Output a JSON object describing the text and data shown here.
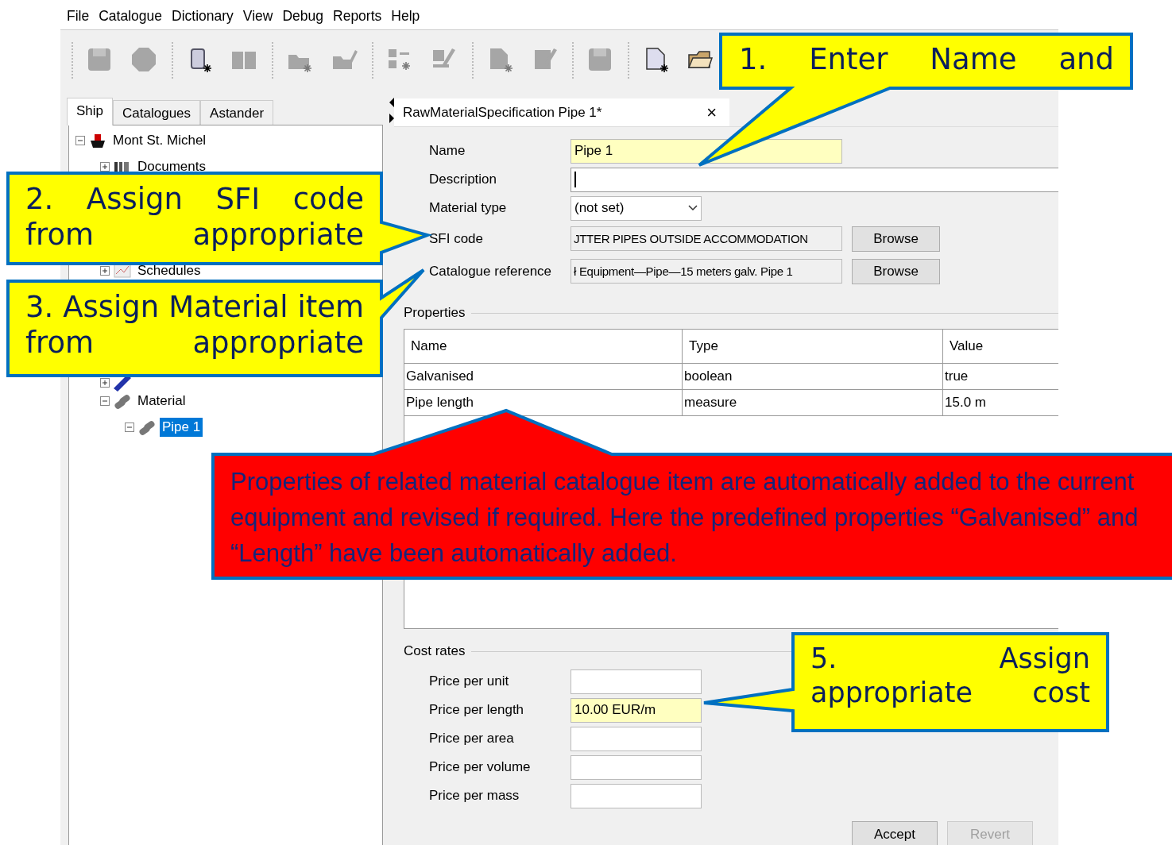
{
  "menu": [
    "File",
    "Catalogue",
    "Dictionary",
    "View",
    "Debug",
    "Reports",
    "Help"
  ],
  "toolbar": [
    {
      "buttons": [
        {
          "disabled": true
        },
        {
          "disabled": true
        }
      ]
    },
    {
      "buttons": [
        {
          "disabled": false
        },
        {
          "disabled": true
        }
      ]
    },
    {
      "buttons": [
        {
          "disabled": true
        },
        {
          "disabled": true
        }
      ]
    },
    {
      "buttons": [
        {
          "disabled": true
        },
        {
          "disabled": true
        }
      ]
    },
    {
      "buttons": [
        {
          "disabled": true
        },
        {
          "disabled": true
        }
      ]
    },
    {
      "buttons": [
        {
          "disabled": true
        }
      ]
    },
    {
      "buttons": [
        {
          "disabled": false
        },
        {
          "disabled": false
        }
      ]
    }
  ],
  "side_tabs": [
    {
      "label": "Ship",
      "selected": true
    },
    {
      "label": "Catalogues",
      "selected": false
    },
    {
      "label": "Astander",
      "selected": false
    }
  ],
  "tree": [
    {
      "label": "Mont St. Michel",
      "expanded": true,
      "selected": false,
      "children": [
        {
          "label": "Documents",
          "expanded": false,
          "selected": false
        },
        {
          "label": "Schedules",
          "expanded": false,
          "selected": false
        },
        {
          "expanded": false
        },
        {
          "label": "Material",
          "expanded": true,
          "selected": false,
          "children": [
            {
              "label": "Pipe 1",
              "expanded": true,
              "selected": true
            }
          ]
        }
      ]
    }
  ],
  "editor": {
    "tab": {
      "title": "RawMaterialSpecification Pipe 1*",
      "close": "×"
    },
    "fields": [
      {
        "kind": "text",
        "label": "Name",
        "value": "Pipe 1",
        "highlighted": true,
        "focused": false
      },
      {
        "kind": "text",
        "label": "Description",
        "highlighted": false,
        "focused": true
      },
      {
        "kind": "select",
        "label": "Material type",
        "value": "(not set)"
      },
      {
        "kind": "browse",
        "label": "SFI code",
        "value": "JTTER PIPES OUTSIDE ACCOMMODATION",
        "button": "Browse"
      },
      {
        "kind": "browse",
        "label": "Catalogue reference",
        "value": "ł Equipment—Pipe—15 meters galv. Pipe 1",
        "button": "Browse"
      }
    ],
    "properties": {
      "title": "Properties",
      "columns": [
        "Name",
        "Type",
        "Value"
      ],
      "rows": [
        [
          "Galvanised",
          "boolean",
          "true"
        ],
        [
          "Pipe length",
          "measure",
          "15.0 m"
        ]
      ]
    },
    "cost_rates": {
      "title": "Cost rates",
      "fields": [
        {
          "label": "Price per unit",
          "highlighted": false
        },
        {
          "label": "Price per length",
          "value": "10.00 EUR/m",
          "highlighted": true
        },
        {
          "label": "Price per area",
          "highlighted": false
        },
        {
          "label": "Price per volume",
          "highlighted": false
        },
        {
          "label": "Price per mass",
          "highlighted": false
        }
      ]
    },
    "buttons": [
      {
        "label": "Accept",
        "disabled": false
      },
      {
        "label": "Revert",
        "disabled": true
      }
    ]
  },
  "callouts": [
    {
      "text": "1. Enter Name and",
      "color": "#ffff00"
    },
    {
      "text": "2. Assign SFI code from appropriate",
      "color": "#ffff00"
    },
    {
      "text": "3. Assign Material item from appropriate",
      "color": "#ffff00"
    },
    {
      "text": "Properties of related material catalogue item are automatically added to the current equipment and revised if required. Here the predefined properties “Galvanised” and “Length” have been automatically added.",
      "color": "#ff0000"
    },
    {
      "text": "5. Assign appropriate cost",
      "color": "#ffff00"
    }
  ]
}
